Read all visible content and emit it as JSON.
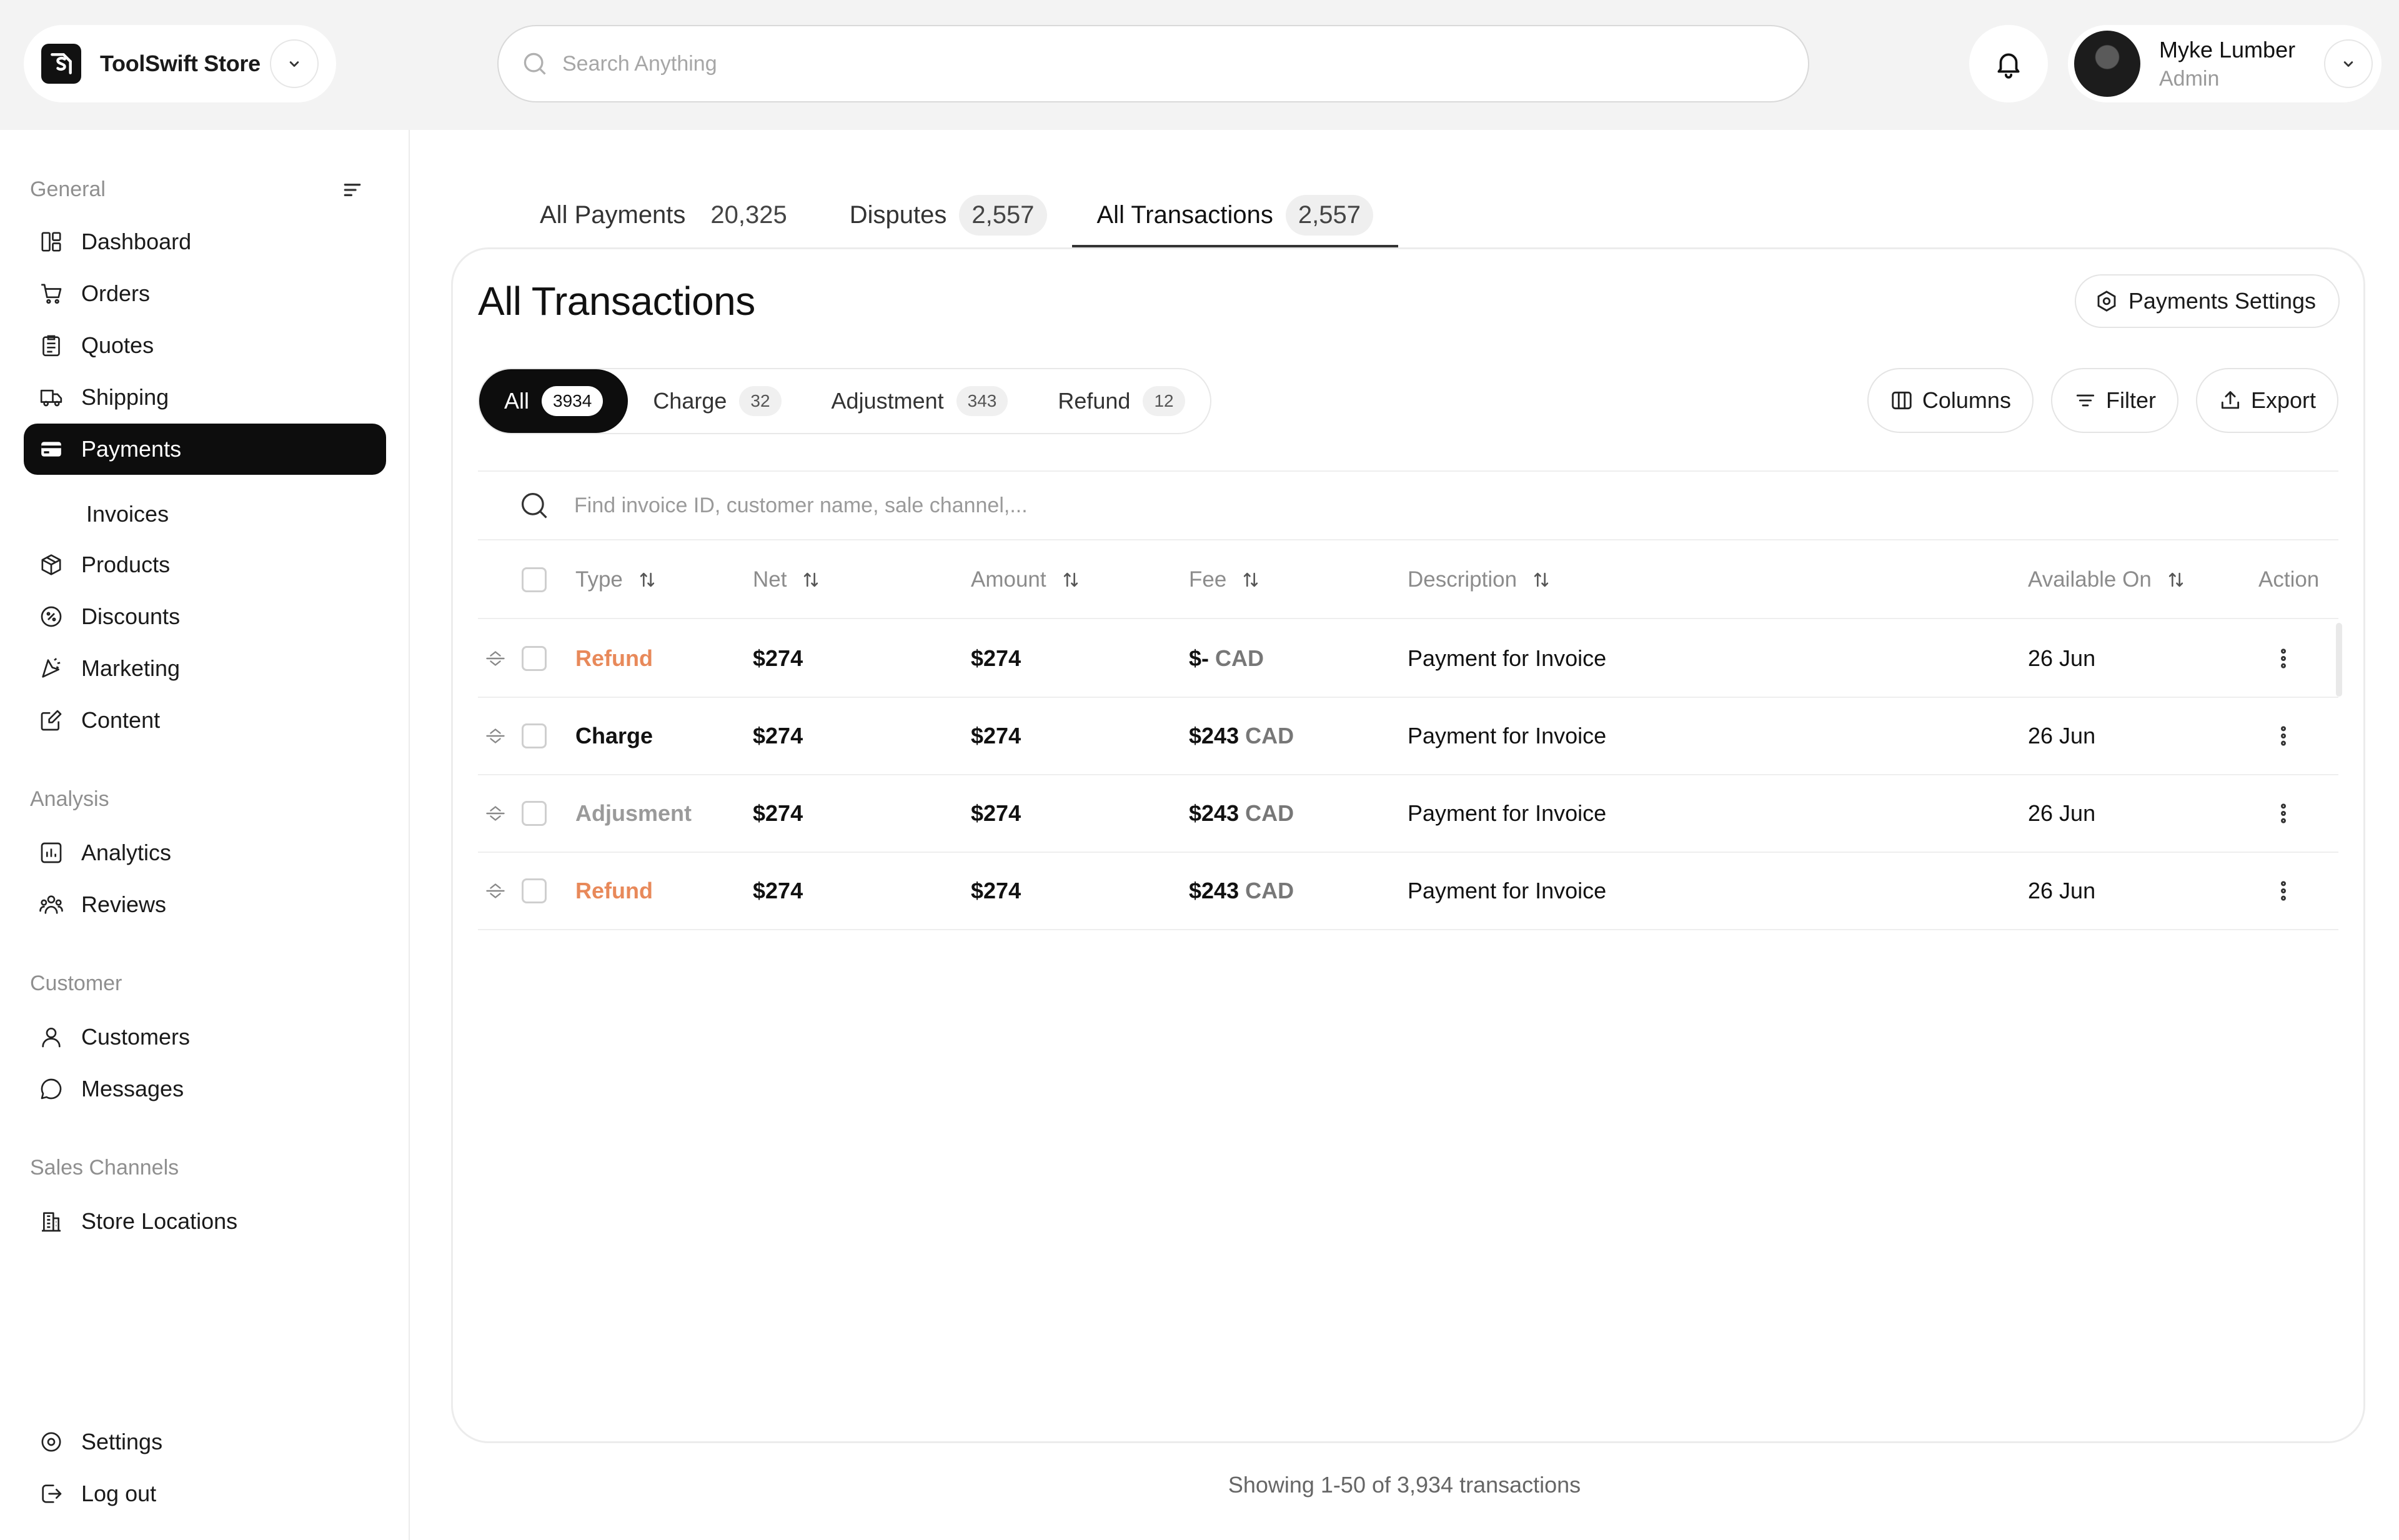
{
  "topbar": {
    "store_name": "ToolSwift Store",
    "search_placeholder": "Search Anything",
    "user_name": "Myke Lumber",
    "user_role": "Admin"
  },
  "sidebar": {
    "section_general": "General",
    "section_analysis": "Analysis",
    "section_customer": "Customer",
    "section_sales": "Sales Channels",
    "items": {
      "dashboard": "Dashboard",
      "orders": "Orders",
      "quotes": "Quotes",
      "shipping": "Shipping",
      "payments": "Payments",
      "invoices": "Invoices",
      "products": "Products",
      "discounts": "Discounts",
      "marketing": "Marketing",
      "content": "Content",
      "analytics": "Analytics",
      "reviews": "Reviews",
      "customers": "Customers",
      "messages": "Messages",
      "store_locations": "Store Locations",
      "settings": "Settings",
      "logout": "Log out"
    },
    "active": "payments"
  },
  "tabs": [
    {
      "label": "All Payments",
      "count": "20,325"
    },
    {
      "label": "Disputes",
      "count": "2,557"
    },
    {
      "label": "All Transactions",
      "count": "2,557"
    }
  ],
  "card": {
    "title": "All Transactions",
    "settings_button": "Payments Settings"
  },
  "segments": [
    {
      "label": "All",
      "count": "3934"
    },
    {
      "label": "Charge",
      "count": "32"
    },
    {
      "label": "Adjustment",
      "count": "343"
    },
    {
      "label": "Refund",
      "count": "12"
    }
  ],
  "toolbar": {
    "columns": "Columns",
    "filter": "Filter",
    "export": "Export"
  },
  "table_search_placeholder": "Find invoice ID, customer name, sale channel,...",
  "columns": {
    "type": "Type",
    "net": "Net",
    "amount": "Amount",
    "fee": "Fee",
    "description": "Description",
    "available_on": "Available On",
    "action": "Action"
  },
  "rows": [
    {
      "type": "Refund",
      "net": "$274",
      "amount": "$274",
      "fee": "$-",
      "fee_cur": "CAD",
      "description": "Payment for Invoice",
      "available_on": "26 Jun"
    },
    {
      "type": "Charge",
      "net": "$274",
      "amount": "$274",
      "fee": "$243",
      "fee_cur": "CAD",
      "description": "Payment for Invoice",
      "available_on": "26 Jun"
    },
    {
      "type": "Adjusment",
      "net": "$274",
      "amount": "$274",
      "fee": "$243",
      "fee_cur": "CAD",
      "description": "Payment for Invoice",
      "available_on": "26 Jun"
    },
    {
      "type": "Refund",
      "net": "$274",
      "amount": "$274",
      "fee": "$243",
      "fee_cur": "CAD",
      "description": "Payment for Invoice",
      "available_on": "26 Jun"
    }
  ],
  "footer": "Showing 1-50 of 3,934 transactions",
  "colors": {
    "refund": "#e8895a",
    "active_bg": "#0d0d0d"
  }
}
